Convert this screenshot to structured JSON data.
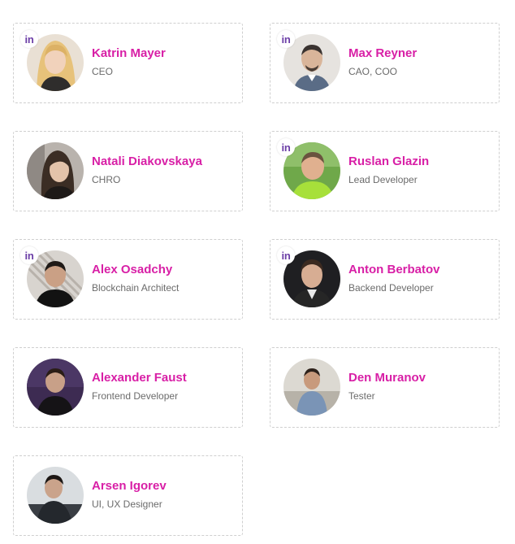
{
  "colors": {
    "name_accent": "#d81fa6",
    "linkedin": "#6c3fa7",
    "card_border": "#cfcfcf",
    "role_text": "#6b6b6b"
  },
  "linkedin_icon_text": "in",
  "team": [
    {
      "name": "Katrin Mayer",
      "role": "CEO",
      "linkedin": true
    },
    {
      "name": "Max Reyner",
      "role": "CAO, COO",
      "linkedin": true
    },
    {
      "name": "Natali Diakovskaya",
      "role": "CHRO",
      "linkedin": false
    },
    {
      "name": "Ruslan Glazin",
      "role": "Lead Developer",
      "linkedin": true
    },
    {
      "name": "Alex Osadchy",
      "role": "Blockchain Architect",
      "linkedin": true
    },
    {
      "name": "Anton Berbatov",
      "role": "Backend Developer",
      "linkedin": true
    },
    {
      "name": "Alexander Faust",
      "role": "Frontend Developer",
      "linkedin": false
    },
    {
      "name": "Den Muranov",
      "role": "Tester",
      "linkedin": false
    },
    {
      "name": "Arsen Igorev",
      "role": "UI, UX Designer",
      "linkedin": false
    }
  ]
}
